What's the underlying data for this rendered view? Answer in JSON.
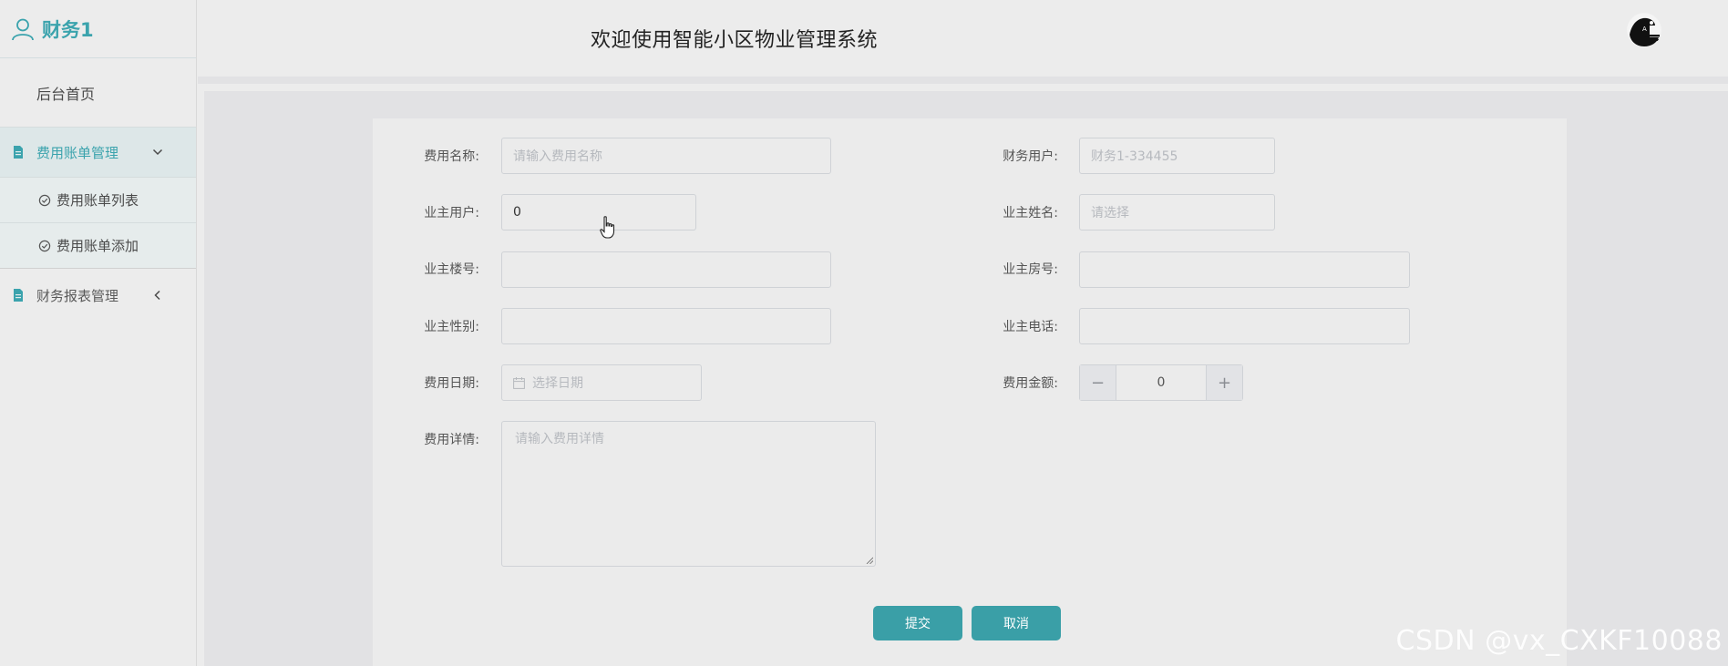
{
  "sidebar": {
    "user_name": "财务1",
    "home": "后台首页",
    "groups": [
      {
        "label": "费用账单管理",
        "expanded": true,
        "items": [
          "费用账单列表",
          "费用账单添加"
        ]
      },
      {
        "label": "财务报表管理",
        "expanded": false
      }
    ]
  },
  "header": {
    "title": "欢迎使用智能小区物业管理系统"
  },
  "form": {
    "fee_name": {
      "label": "费用名称:",
      "placeholder": "请输入费用名称",
      "value": ""
    },
    "finance_user": {
      "label": "财务用户:",
      "placeholder": "财务1-334455",
      "value": ""
    },
    "owner_user": {
      "label": "业主用户:",
      "value": "0"
    },
    "owner_name": {
      "label": "业主姓名:",
      "placeholder": "请选择",
      "value": ""
    },
    "owner_building": {
      "label": "业主楼号:",
      "value": ""
    },
    "owner_room": {
      "label": "业主房号:",
      "value": ""
    },
    "owner_gender": {
      "label": "业主性别:",
      "value": ""
    },
    "owner_phone": {
      "label": "业主电话:",
      "value": ""
    },
    "fee_date": {
      "label": "费用日期:",
      "placeholder": "选择日期",
      "value": ""
    },
    "fee_amount": {
      "label": "费用金额:",
      "value": "0",
      "minus": "−",
      "plus": "+"
    },
    "fee_detail": {
      "label": "费用详情:",
      "placeholder": "请输入费用详情",
      "value": ""
    },
    "submit": "提交",
    "cancel": "取消"
  },
  "watermark": "CSDN @vx_CXKF10088",
  "colors": {
    "accent": "#3a9fa7",
    "background": "#ececec"
  }
}
